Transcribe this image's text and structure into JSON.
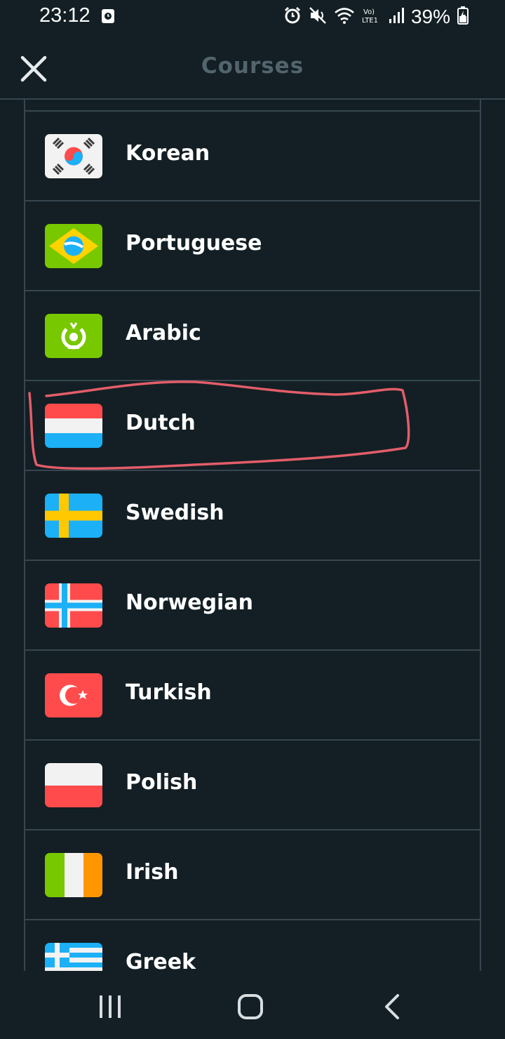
{
  "status_bar": {
    "time": "23:12",
    "battery": "39%",
    "icons": [
      "alarm-icon",
      "mute-icon",
      "wifi-icon",
      "volte-icon",
      "signal-icon",
      "battery-charging-icon"
    ]
  },
  "header": {
    "title": "Courses",
    "close_icon": "close-icon"
  },
  "courses": [
    {
      "name": "Korean",
      "flag": "korea-flag-icon"
    },
    {
      "name": "Portuguese",
      "flag": "brazil-flag-icon"
    },
    {
      "name": "Arabic",
      "flag": "arabic-flag-icon"
    },
    {
      "name": "Dutch",
      "flag": "netherlands-flag-icon",
      "highlighted": true
    },
    {
      "name": "Swedish",
      "flag": "sweden-flag-icon"
    },
    {
      "name": "Norwegian",
      "flag": "norway-flag-icon"
    },
    {
      "name": "Turkish",
      "flag": "turkey-flag-icon"
    },
    {
      "name": "Polish",
      "flag": "poland-flag-icon"
    },
    {
      "name": "Irish",
      "flag": "ireland-flag-icon"
    },
    {
      "name": "Greek",
      "flag": "greece-flag-icon"
    }
  ],
  "colors": {
    "background": "#131f24",
    "divider": "#37464f",
    "header_title": "#52656d",
    "highlight_stroke": "#e35d6a"
  },
  "nav_bar": {
    "icons": [
      "recent-apps-icon",
      "home-icon",
      "back-icon"
    ]
  }
}
